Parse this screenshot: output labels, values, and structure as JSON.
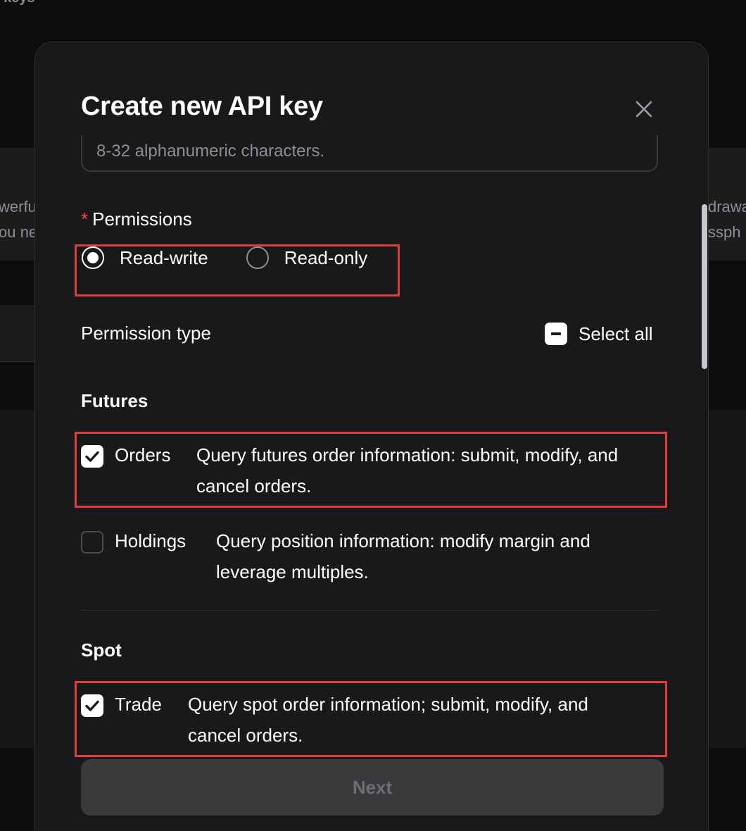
{
  "background": {
    "page_title": "I keys",
    "left_fragment": [
      "werfu",
      "ou ne"
    ],
    "right_fragment": [
      "drawa",
      "ssph"
    ]
  },
  "modal": {
    "title": "Create new API key",
    "name_input": {
      "value": "",
      "placeholder": "8-32 alphanumeric characters."
    },
    "permissions": {
      "required_mark": "*",
      "label": "Permissions",
      "options": [
        {
          "label": "Read-write",
          "checked": true
        },
        {
          "label": "Read-only",
          "checked": false
        }
      ]
    },
    "permission_type": {
      "label": "Permission type",
      "select_all_label": "Select all"
    },
    "sections": [
      {
        "title": "Futures",
        "items": [
          {
            "name": "Orders",
            "description": "Query futures order information: submit, modify, and cancel orders.",
            "checked": true
          },
          {
            "name": "Holdings",
            "description": "Query position information: modify margin and leverage multiples.",
            "checked": false
          }
        ]
      },
      {
        "title": "Spot",
        "items": [
          {
            "name": "Trade",
            "description": "Query spot order information; submit, modify, and cancel orders.",
            "checked": true
          }
        ]
      }
    ],
    "next_label": "Next"
  },
  "colors": {
    "background": "#0d0d0e",
    "modal": "#19191b",
    "highlight": "#e03c3c",
    "required": "#f04a3e",
    "button_disabled": "#3a3a3d"
  },
  "icons": {
    "close": "close-icon",
    "check": "check-icon",
    "indeterminate": "minus-icon"
  }
}
